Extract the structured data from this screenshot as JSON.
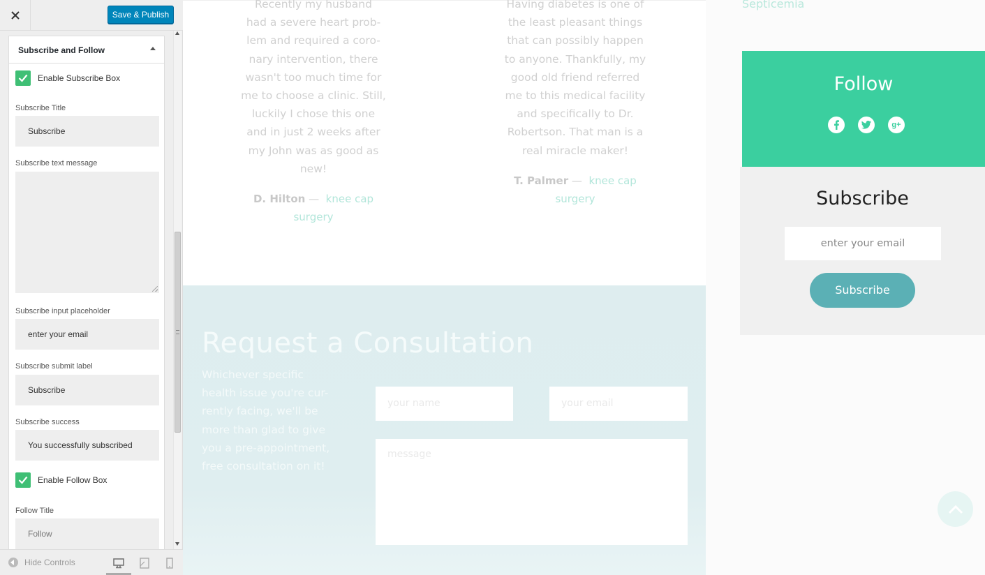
{
  "header": {
    "close_icon": "close-icon",
    "save_label": "Save & Publish",
    "save_color": "#0085ba"
  },
  "section": {
    "title": "Subscribe and Follow",
    "enable_subscribe_label": "Enable Subscribe Box",
    "enable_subscribe_checked": true,
    "subscribe_title_label": "Subscribe Title",
    "subscribe_title_value": "Subscribe",
    "subscribe_text_label": "Subscribe text message",
    "subscribe_text_value": "",
    "subscribe_placeholder_label": "Subscribe input placeholder",
    "subscribe_placeholder_value": "enter your email",
    "submit_label_label": "Subscribe submit label",
    "submit_label_value": "Subscribe",
    "success_label": "Subscribe success",
    "success_value": "You successfully subscribed",
    "enable_follow_label": "Enable Follow Box",
    "enable_follow_checked": true,
    "follow_title_label": "Follow Title",
    "follow_title_value": "Follow",
    "check_color": "#3fbf75"
  },
  "footer": {
    "hide_controls_label": "Hide Controls",
    "devices": [
      "desktop-icon",
      "tablet-icon",
      "mobile-icon"
    ]
  },
  "preview": {
    "testimonial_1": {
      "lines": [
        "Recently my husband",
        "had a severe heart prob-",
        "lem and required a coro-",
        "nary intervention, there",
        "wasn't too much time for",
        "me to choose a clinic. Still,",
        "luckily I chose this one",
        "and in just 2 weeks after",
        "my John was as good as",
        "new!"
      ],
      "author": "D. Hilton",
      "dash": "—",
      "link_line1": "knee cap",
      "link_line2": "surgery"
    },
    "testimonial_2": {
      "lines": [
        "Having diabetes is one of",
        "the least pleasant things",
        "that can possibly happen",
        "to anyone. Thankfully, my",
        "good old friend referred",
        "me to this medical facility",
        "and specifically to Dr.",
        "Robertson. That man is a",
        "real miracle maker!"
      ],
      "author": "T. Palmer",
      "dash": "—",
      "link_line1": "knee cap",
      "link_line2": "surgery"
    },
    "consultation": {
      "title": "Request a Consultation",
      "text_lines": [
        "Whichever specific",
        "health issue you're cur-",
        "rently facing, we'll be",
        "more than glad to give",
        "you a pre-appointment,",
        "free consultation on it!"
      ],
      "name_placeholder": "your name",
      "email_placeholder": "your email",
      "message_placeholder": "message"
    },
    "sidebar": {
      "top_link": "Septicemia",
      "follow_title": "Follow",
      "follow_bg": "#3bcf9f",
      "social_icons": [
        "facebook-icon",
        "twitter-icon",
        "google-plus-icon"
      ],
      "subscribe_title": "Subscribe",
      "subscribe_placeholder": "enter your email",
      "subscribe_button": "Subscribe",
      "subscribe_button_color": "#5bb0b5"
    },
    "back_to_top_icon": "chevron-up-icon"
  }
}
